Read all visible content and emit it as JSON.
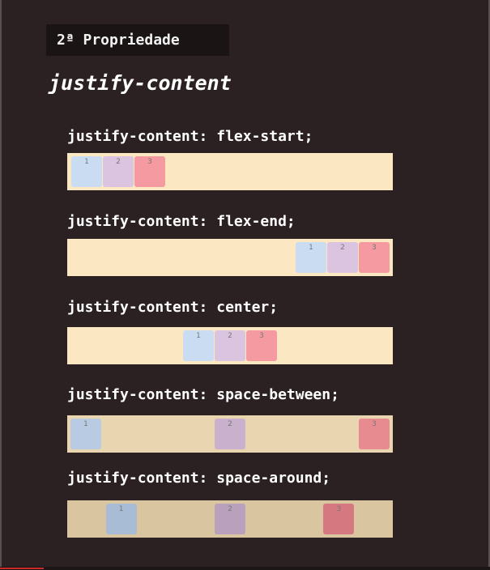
{
  "section": {
    "badge": "2ª Propriedade"
  },
  "title": "justify-content",
  "examples": [
    {
      "label": "justify-content: flex-start;",
      "items": [
        "1",
        "2",
        "3"
      ]
    },
    {
      "label": "justify-content: flex-end;",
      "items": [
        "1",
        "2",
        "3"
      ]
    },
    {
      "label": "justify-content: center;",
      "items": [
        "1",
        "2",
        "3"
      ]
    },
    {
      "label": "justify-content: space-between;",
      "items": [
        "1",
        "2",
        "3"
      ]
    },
    {
      "label": "justify-content: space-around;",
      "items": [
        "1",
        "2",
        "3"
      ]
    }
  ],
  "colors": {
    "background": "#2b2022",
    "container": "#fbe8c3",
    "item_1": "#c9dcf1",
    "item_2": "#dbc4df",
    "item_3": "#f59aa0",
    "progress": "#cc2a2a"
  },
  "video": {
    "progress_fraction": 0.09
  }
}
